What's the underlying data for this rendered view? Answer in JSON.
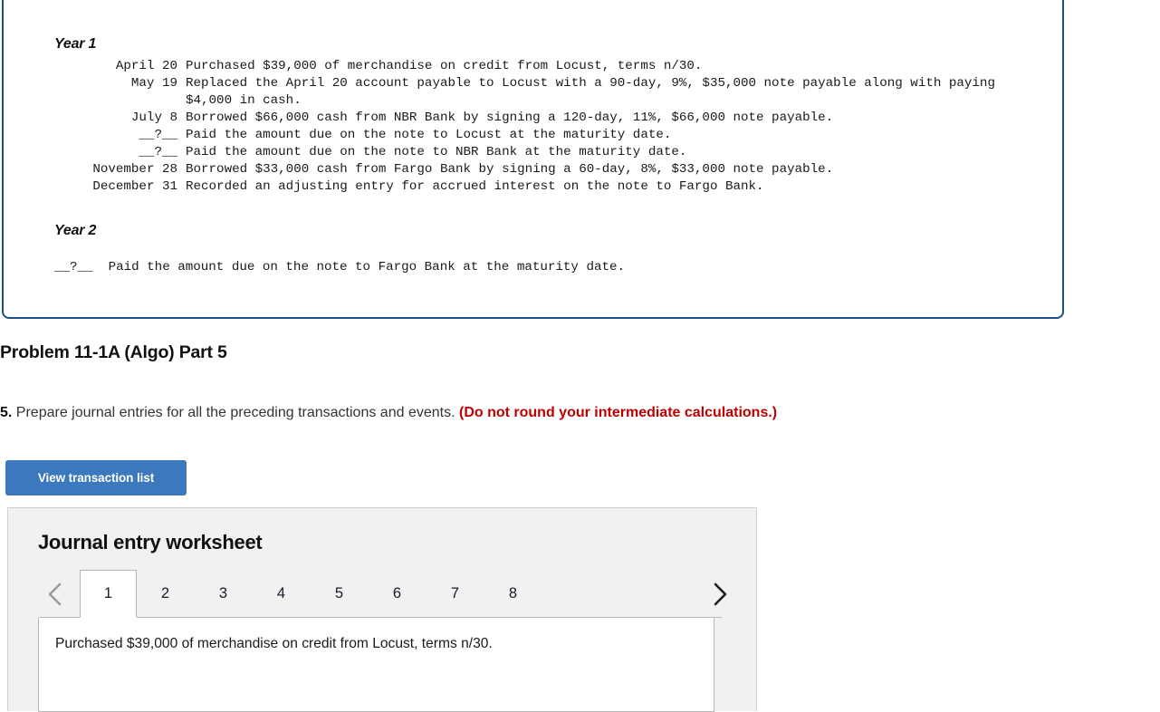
{
  "problem_box": {
    "year1_heading": "Year 1",
    "year1_rows": [
      {
        "date": "April 20",
        "desc": "Purchased $39,000 of merchandise on credit from Locust, terms n/30."
      },
      {
        "date": "May 19",
        "desc": "Replaced the April 20 account payable to Locust with a 90-day, 9%, $35,000 note payable along with paying\n$4,000 in cash."
      },
      {
        "date": "July 8",
        "desc": "Borrowed $66,000 cash from NBR Bank by signing a 120-day, 11%, $66,000 note payable."
      },
      {
        "date": "__?__",
        "desc": "Paid the amount due on the note to Locust at the maturity date."
      },
      {
        "date": "__?__",
        "desc": "Paid the amount due on the note to NBR Bank at the maturity date."
      },
      {
        "date": "November 28",
        "desc": "Borrowed $33,000 cash from Fargo Bank by signing a 60-day, 8%, $33,000 note payable."
      },
      {
        "date": "December 31",
        "desc": "Recorded an adjusting entry for accrued interest on the note to Fargo Bank."
      }
    ],
    "year2_heading": "Year 2",
    "year2_line": "__?__  Paid the amount due on the note to Fargo Bank at the maturity date."
  },
  "part_heading": "Problem 11-1A (Algo) Part 5",
  "requirement": {
    "number": "5.",
    "text": "Prepare journal entries for all the preceding transactions and events.",
    "note": "(Do not round your intermediate calculations.)"
  },
  "view_transaction_button": "View transaction list",
  "worksheet": {
    "title": "Journal entry worksheet",
    "prev_arrow_icon": "chevron-left-icon",
    "next_arrow_icon": "chevron-right-icon",
    "tabs": [
      "1",
      "2",
      "3",
      "4",
      "5",
      "6",
      "7",
      "8"
    ],
    "active_tab_index": 0,
    "entry_text": "Purchased $39,000 of merchandise on credit from Locust, terms n/30."
  },
  "colors": {
    "box_border": "#1d4f8c",
    "button_blue": "#3c78bd",
    "note_red": "#c00000",
    "panel_gray": "#f1f1f1"
  }
}
